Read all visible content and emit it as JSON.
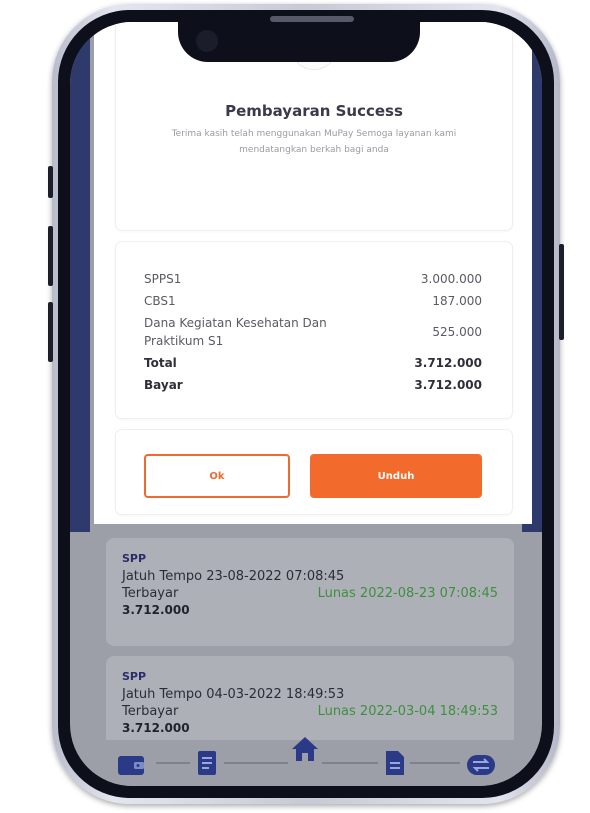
{
  "success": {
    "title": "Pembayaran Success",
    "message": "Terima kasih telah menggunakan MuPay Semoga layanan kami mendatangkan berkah bagi anda"
  },
  "items": [
    {
      "label": "SPPS1",
      "value": "3.000.000"
    },
    {
      "label": "CBS1",
      "value": "187.000"
    },
    {
      "label": "Dana Kegiatan Kesehatan Dan Praktikum S1",
      "value": "525.000"
    }
  ],
  "total": {
    "label": "Total",
    "value": "3.712.000"
  },
  "bayar": {
    "label": "Bayar",
    "value": "3.712.000"
  },
  "buttons": {
    "ok": "Ok",
    "download": "Unduh"
  },
  "history": [
    {
      "type": "SPP",
      "due": "Jatuh Tempo 23-08-2022 07:08:45",
      "paid_label": "Terbayar",
      "status": "Lunas 2022-08-23 07:08:45",
      "amount": "3.712.000"
    },
    {
      "type": "SPP",
      "due": "Jatuh Tempo 04-03-2022 18:49:53",
      "paid_label": "Terbayar",
      "status": "Lunas 2022-03-04 18:49:53",
      "amount": "3.712.000"
    }
  ],
  "nav": [
    "wallet-icon",
    "receipt-icon",
    "home-icon",
    "document-icon",
    "transfer-icon"
  ],
  "colors": {
    "accent": "#f26a2c",
    "success": "#4caf50",
    "navy": "#2d3a6b",
    "lunas_green": "#3e8f3e"
  }
}
